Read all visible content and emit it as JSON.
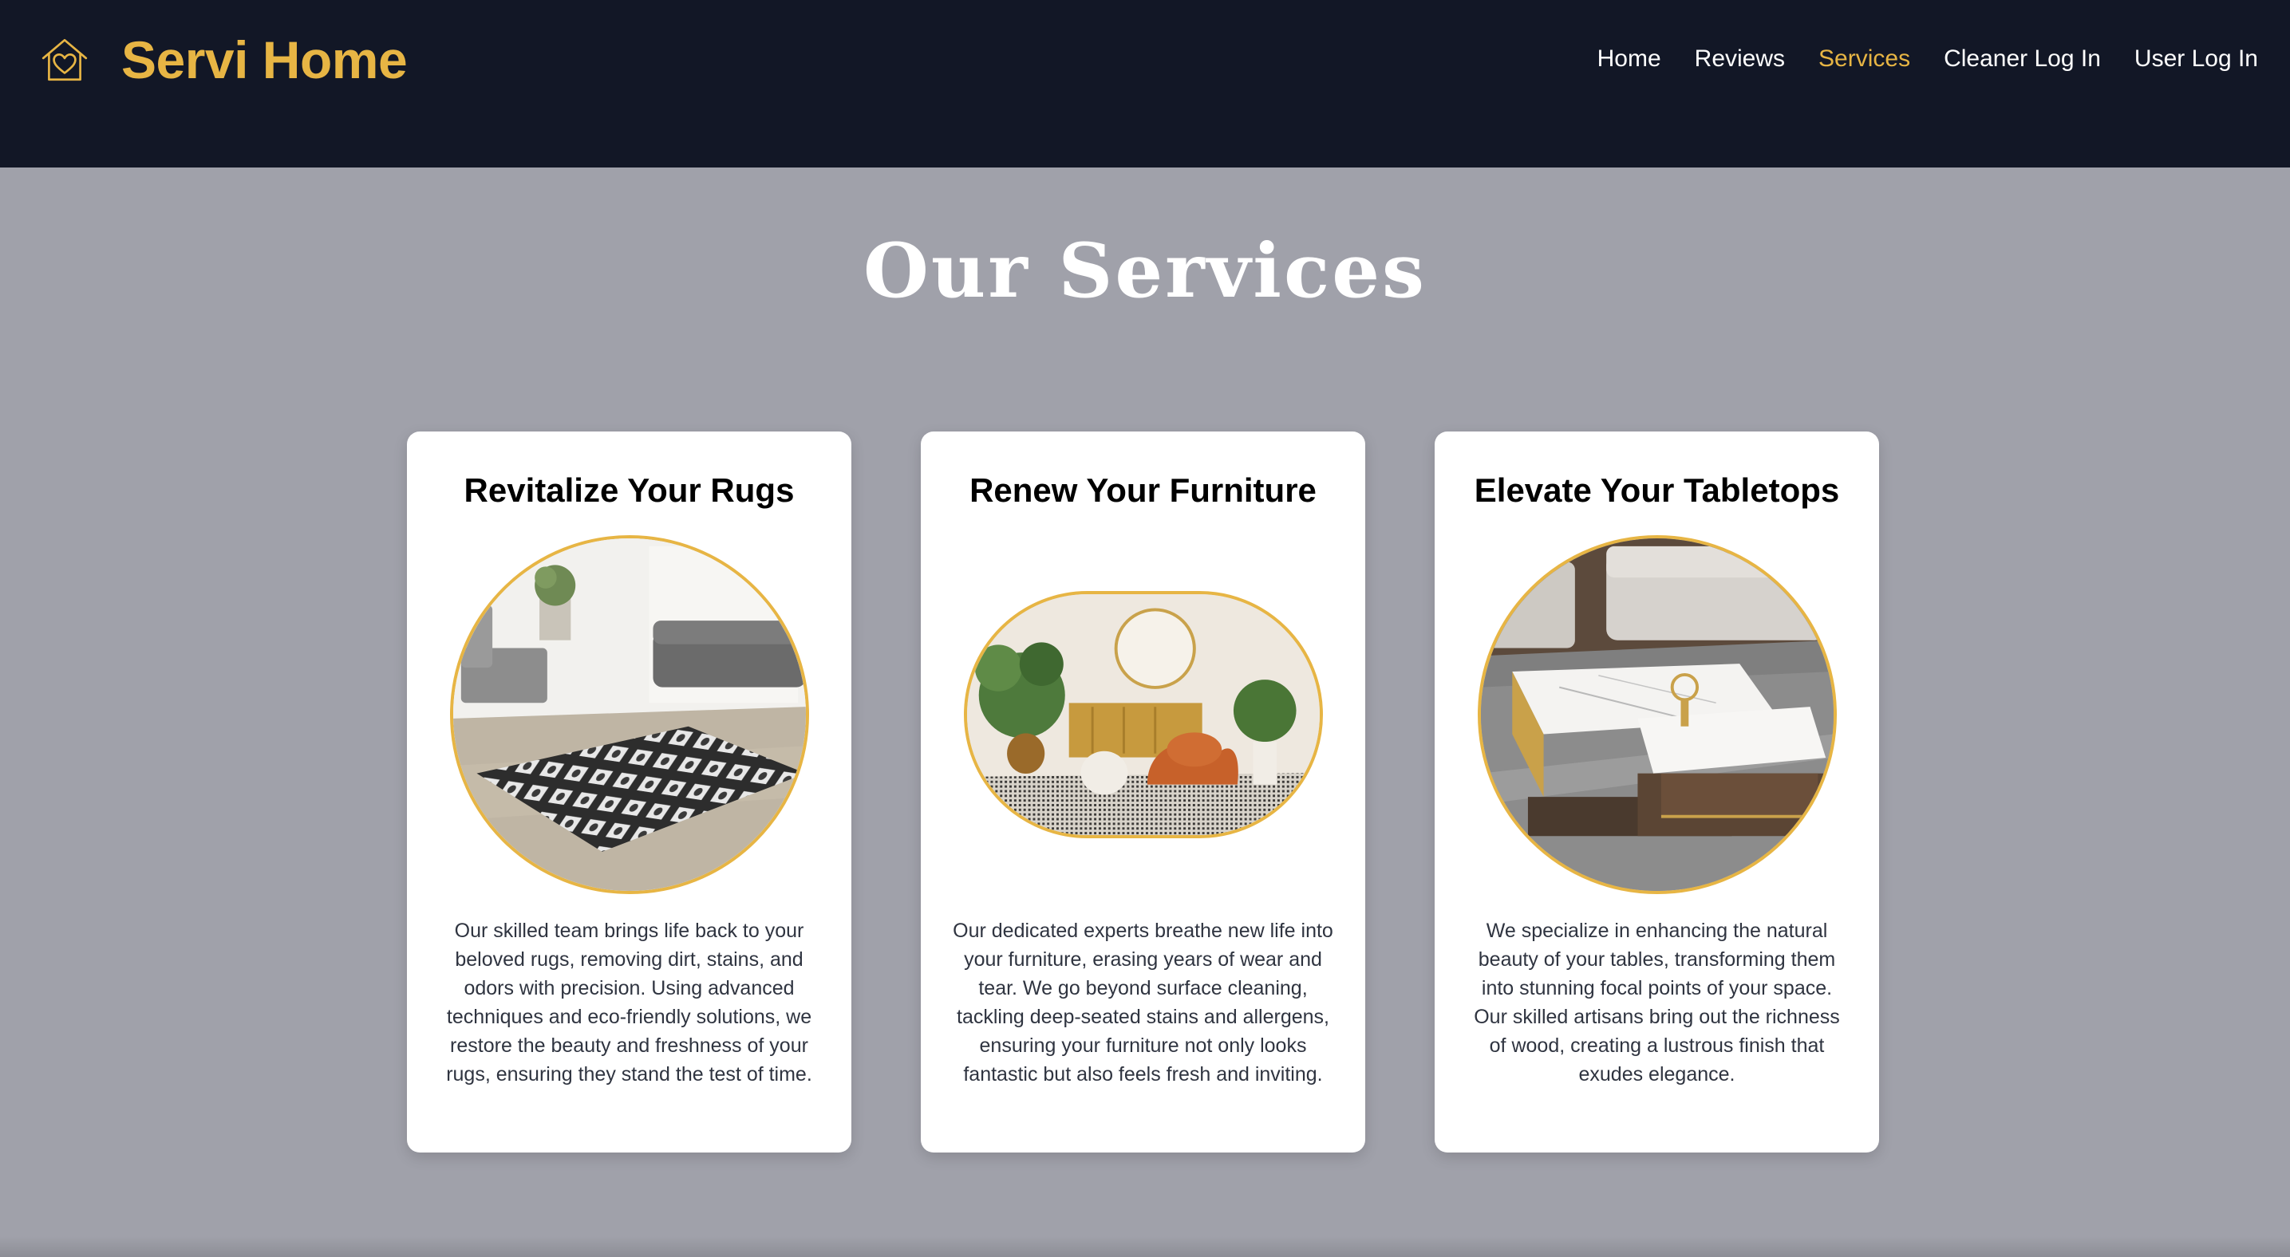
{
  "brand": {
    "name": "Servi Home",
    "icon": "house-heart-icon",
    "accent_color": "#e7b544"
  },
  "nav": {
    "links": [
      {
        "label": "Home",
        "active": false
      },
      {
        "label": "Reviews",
        "active": false
      },
      {
        "label": "Services",
        "active": true
      },
      {
        "label": "Cleaner Log In",
        "active": false
      },
      {
        "label": "User Log In",
        "active": false
      }
    ]
  },
  "page": {
    "title": "Our Services"
  },
  "cards": [
    {
      "title": "Revitalize Your Rugs",
      "image": "rug-living-room-photo",
      "text": "Our skilled team brings life back to your beloved rugs, removing dirt, stains, and odors with precision. Using advanced techniques and eco-friendly solutions, we restore the beauty and freshness of your rugs, ensuring they stand the test of time."
    },
    {
      "title": "Renew Your Furniture",
      "image": "furniture-living-room-photo",
      "text": "Our dedicated experts breathe new life into your furniture, erasing years of wear and tear. We go beyond surface cleaning, tackling deep-seated stains and allergens, ensuring your furniture not only looks fantastic but also feels fresh and inviting."
    },
    {
      "title": "Elevate Your Tabletops",
      "image": "marble-coffee-table-photo",
      "text": "We specialize in enhancing the natural beauty of your tables, transforming them into stunning focal points of your space. Our skilled artisans bring out the richness of wood, creating a lustrous finish that exudes elegance."
    }
  ]
}
